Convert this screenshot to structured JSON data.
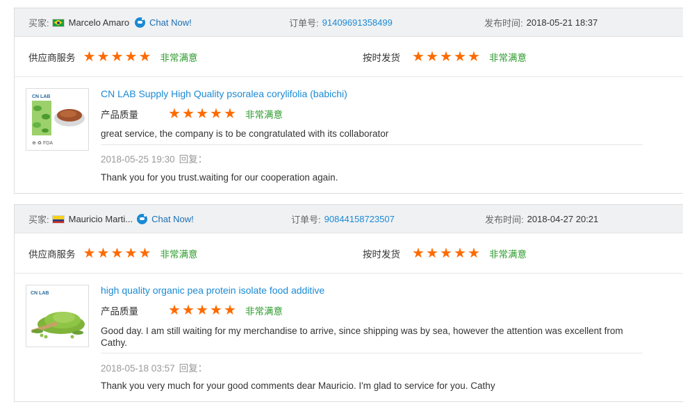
{
  "reviews": [
    {
      "buyer_label": "买家:",
      "buyer_name": "Marcelo Amaro",
      "buyer_flag": "brazil-flag",
      "chat_label": "Chat Now!",
      "order_label": "订单号:",
      "order_number": "91409691358499",
      "date_label": "发布时间:",
      "date_value": "2018-05-21 18:37",
      "supplier_service_label": "供应商服务",
      "supplier_service_rating": 5,
      "supplier_service_text": "非常满意",
      "shipping_label": "按时发货",
      "shipping_rating": 5,
      "shipping_text": "非常满意",
      "product_title": "CN LAB Supply High Quality psoralea corylifolia (babichi)",
      "quality_label": "产品质量",
      "quality_rating": 5,
      "quality_text": "非常满意",
      "comment": "great service, the company is to be congratulated with its collaborator",
      "reply_date": "2018-05-25 19:30",
      "reply_label": "回复：",
      "reply_text": "Thank you for you trust.waiting for our cooperation again."
    },
    {
      "buyer_label": "买家:",
      "buyer_name": "Mauricio Marti...",
      "buyer_flag": "colombia-flag",
      "chat_label": "Chat Now!",
      "order_label": "订单号:",
      "order_number": "90844158723507",
      "date_label": "发布时间:",
      "date_value": "2018-04-27 20:21",
      "supplier_service_label": "供应商服务",
      "supplier_service_rating": 5,
      "supplier_service_text": "非常满意",
      "shipping_label": "按时发货",
      "shipping_rating": 5,
      "shipping_text": "非常满意",
      "product_title": "high quality organic pea protein isolate food additive",
      "quality_label": "产品质量",
      "quality_rating": 5,
      "quality_text": "非常满意",
      "comment": "Good day. I am still waiting for my merchandise to arrive, since shipping was by sea, however the attention was excellent from Cathy.",
      "reply_date": "2018-05-18 03:57",
      "reply_label": "回复：",
      "reply_text": "Thank you very much for your good comments dear Mauricio. I'm glad to service for you. Cathy"
    }
  ],
  "thumbs": [
    {
      "logo_text": "CN LAB",
      "tags": "⊕ ♻ FDA"
    },
    {
      "logo_text": "CN LAB"
    }
  ],
  "colors": {
    "star": "#ff6a00",
    "satisfied": "#2d9a2d",
    "link": "#1a8ad4",
    "header_bg": "#f0f1f3"
  }
}
